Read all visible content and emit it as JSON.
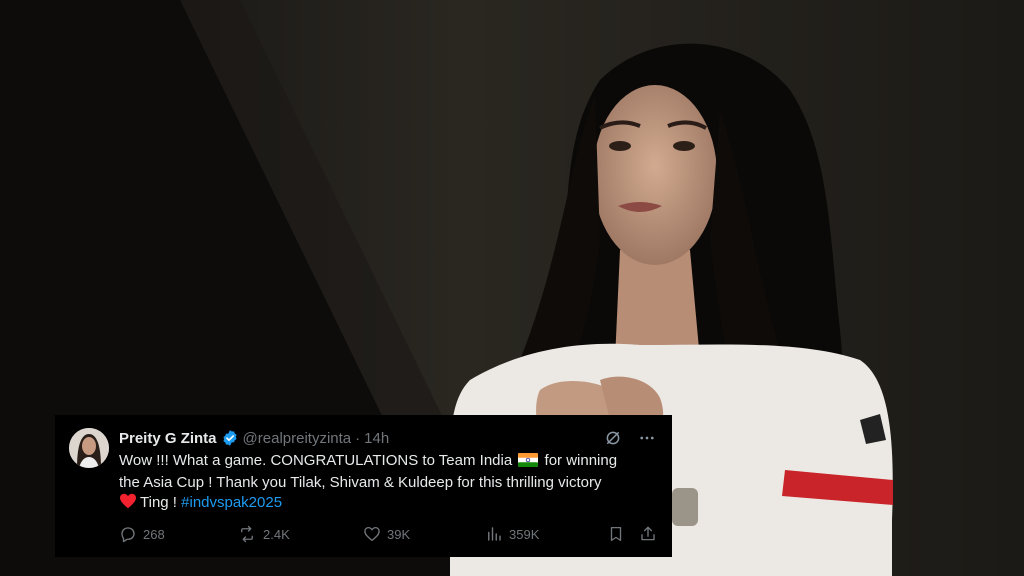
{
  "tweet": {
    "display_name": "Preity G Zinta",
    "verified_icon": "verified-badge-icon",
    "handle": "@realpreityzinta",
    "separator": "·",
    "time": "14h",
    "text_line1_a": "Wow !!! What a game. CONGRATULATIONS to Team India",
    "text_line1_b": "for winning",
    "text_line2": "the Asia Cup !  Thank you Tilak, Shivam & Kuldeep for this thrilling victory",
    "text_line3": "Ting !",
    "hashtag": "#indvspak2025",
    "stats": {
      "replies": "268",
      "reposts": "2.4K",
      "likes": "39K",
      "views": "359K"
    },
    "colors": {
      "card_bg": "#000000",
      "text": "#e7e9ea",
      "muted": "#71767b",
      "link": "#1d9bf0",
      "heart": "#f4212e"
    }
  }
}
